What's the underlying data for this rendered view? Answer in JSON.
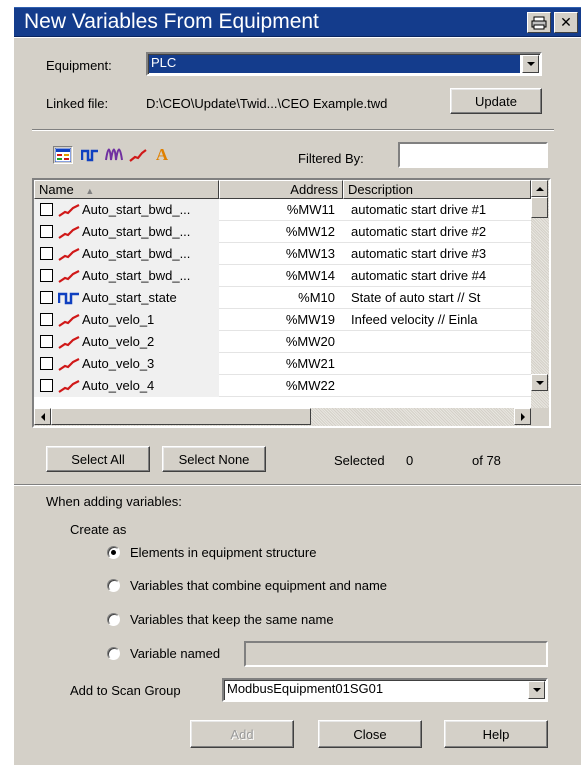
{
  "window": {
    "title": "New Variables From Equipment",
    "print_icon": "printer-icon",
    "close_glyph": "✕"
  },
  "equipment": {
    "label": "Equipment:",
    "value": "PLC"
  },
  "linked_file": {
    "label": "Linked file:",
    "path": "D:\\CEO\\Update\\Twid...\\CEO Example.twd",
    "update_label": "Update"
  },
  "toolbar": {
    "icons": [
      "table-view-icon",
      "digital-signal-icon",
      "waveform-icon",
      "analog-trend-icon",
      "text-letter-icon"
    ],
    "letter_glyph": "A",
    "filtered_by_label": "Filtered By:",
    "filter_value": ""
  },
  "list": {
    "columns": [
      "Name",
      "Address",
      "Description"
    ],
    "rows": [
      {
        "name": "Auto_start_bwd_...",
        "address": "%MW11",
        "description": "automatic start drive #1",
        "icon": "analog-trend-icon"
      },
      {
        "name": "Auto_start_bwd_...",
        "address": "%MW12",
        "description": "automatic start drive #2",
        "icon": "analog-trend-icon"
      },
      {
        "name": "Auto_start_bwd_...",
        "address": "%MW13",
        "description": "automatic start drive #3",
        "icon": "analog-trend-icon"
      },
      {
        "name": "Auto_start_bwd_...",
        "address": "%MW14",
        "description": "automatic start drive #4",
        "icon": "analog-trend-icon"
      },
      {
        "name": "Auto_start_state",
        "address": "%M10",
        "description": "State of auto start // St",
        "icon": "digital-signal-icon"
      },
      {
        "name": "Auto_velo_1",
        "address": "%MW19",
        "description": "Infeed velocity // Einla",
        "icon": "analog-trend-icon"
      },
      {
        "name": "Auto_velo_2",
        "address": "%MW20",
        "description": "",
        "icon": "analog-trend-icon"
      },
      {
        "name": "Auto_velo_3",
        "address": "%MW21",
        "description": "",
        "icon": "analog-trend-icon"
      },
      {
        "name": "Auto_velo_4",
        "address": "%MW22",
        "description": "",
        "icon": "analog-trend-icon"
      }
    ]
  },
  "selection": {
    "select_all": "Select All",
    "select_none": "Select None",
    "selected_label": "Selected",
    "selected_count": "0",
    "total_label": "of 78"
  },
  "adding": {
    "heading": "When adding variables:",
    "create_as": "Create as",
    "options": [
      {
        "label": "Elements in equipment structure",
        "checked": true
      },
      {
        "label": "Variables that combine equipment and name",
        "checked": false
      },
      {
        "label": "Variables that keep the same name",
        "checked": false
      },
      {
        "label": "Variable named",
        "checked": false
      }
    ],
    "variable_named_value": ""
  },
  "scan_group": {
    "label": "Add to Scan Group",
    "value": "ModbusEquipment01SG01"
  },
  "footer": {
    "add": "Add",
    "close": "Close",
    "help": "Help"
  },
  "colors": {
    "title_bar": "#143c8c",
    "dialog_bg": "#d4d0c8",
    "combo_selected_bg": "#143c8c",
    "analog_icon": "#d01818",
    "digital_icon": "#1040c0",
    "waveform_icon": "#7030a0",
    "letter_icon": "#e08000"
  }
}
